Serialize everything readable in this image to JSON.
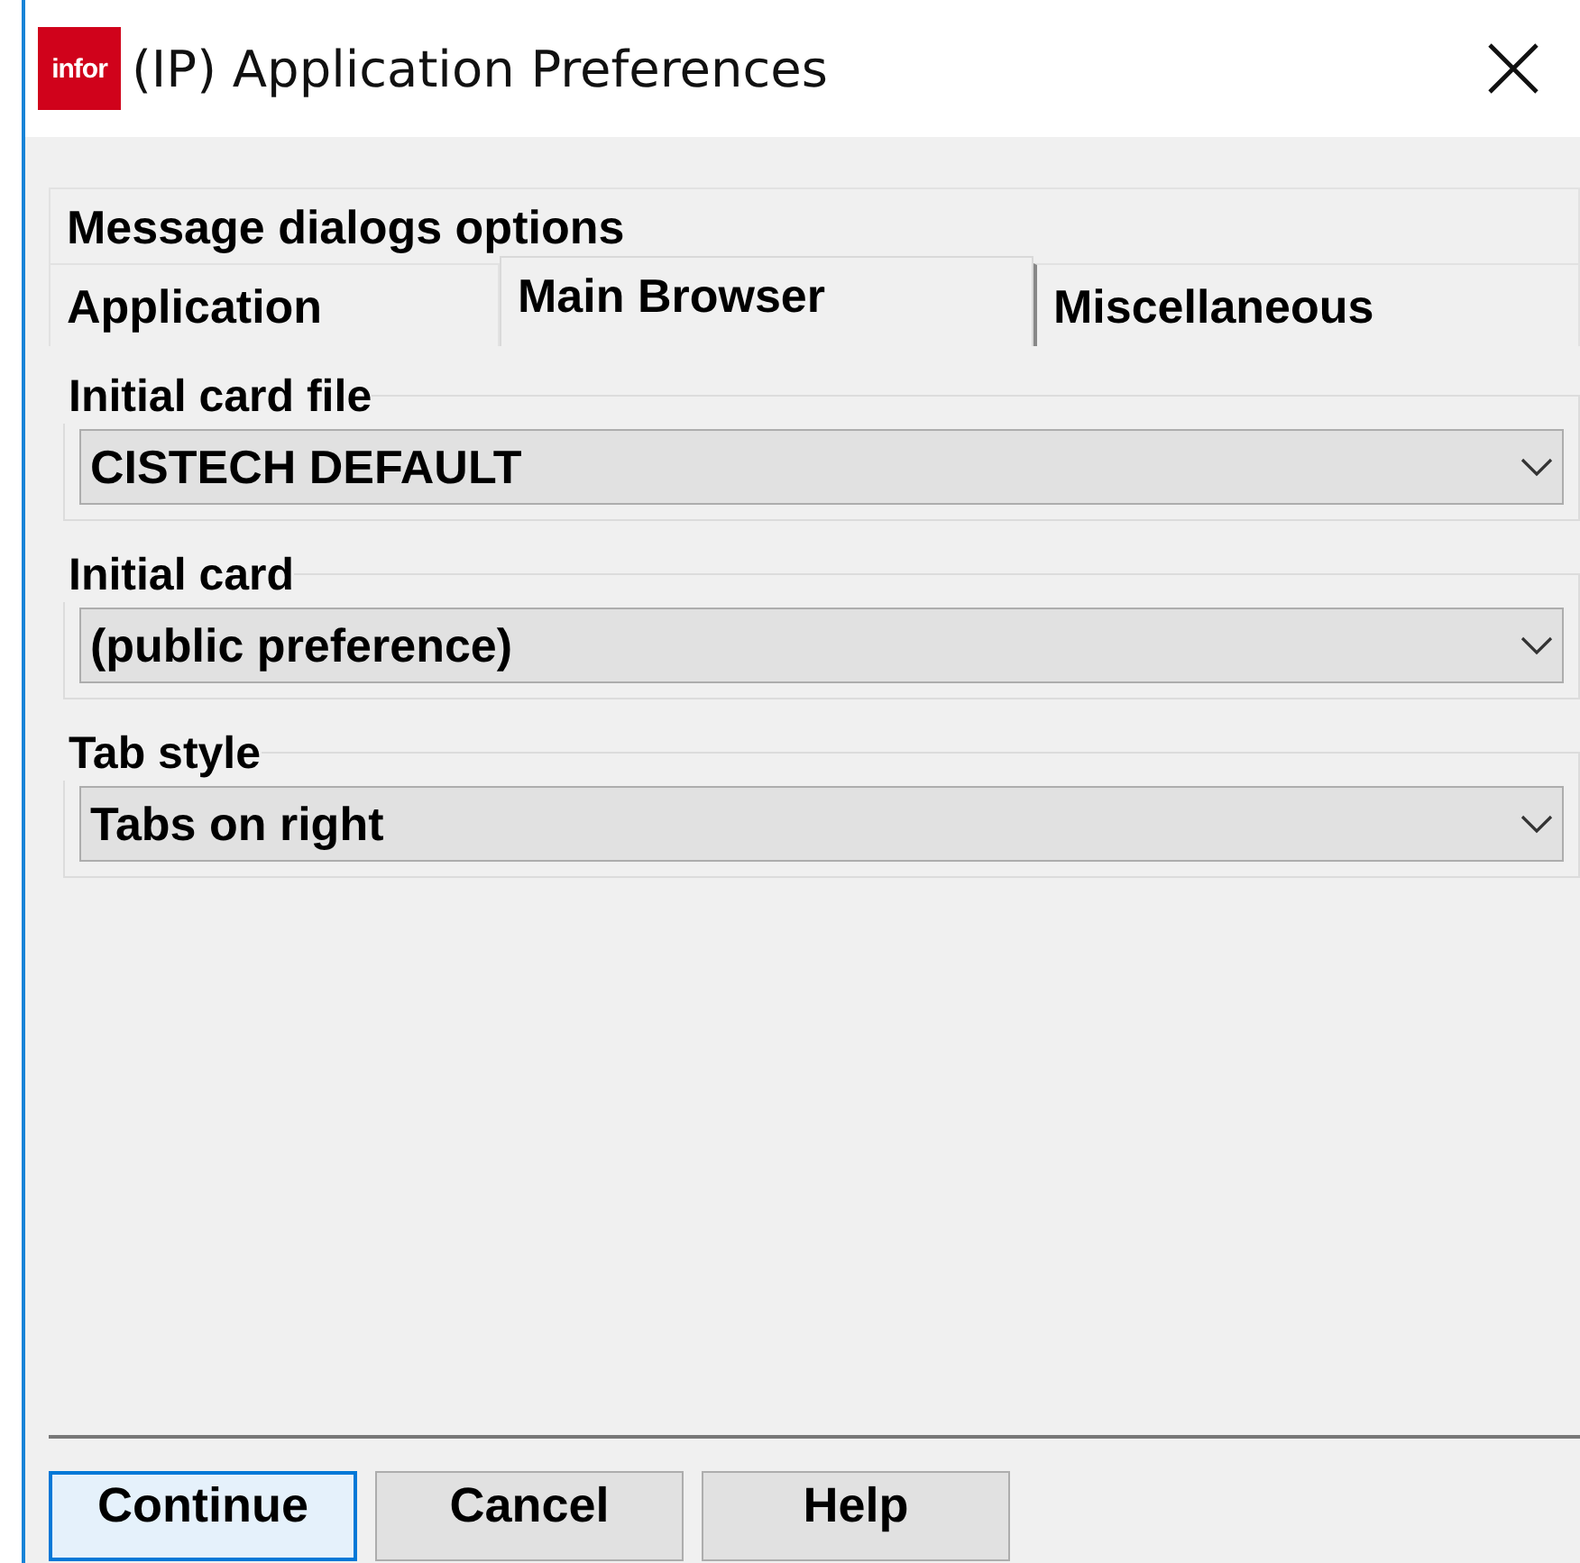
{
  "window": {
    "title": "(IP) Application Preferences",
    "logo": "infor"
  },
  "tab_rows": [
    [
      {
        "label": "Message dialogs options",
        "selected": false
      }
    ],
    [
      {
        "label": "Application",
        "selected": false
      },
      {
        "label": "Main Browser",
        "selected": true
      },
      {
        "label": "Miscellaneous",
        "selected": false
      }
    ]
  ],
  "groups": [
    {
      "label": "Initial card file",
      "value": "CISTECH DEFAULT"
    },
    {
      "label": "Initial card",
      "value": "(public preference)"
    },
    {
      "label": "Tab style",
      "value": "Tabs on right"
    }
  ],
  "buttons": [
    {
      "label": "Continue",
      "focused": true
    },
    {
      "label": "Cancel",
      "focused": false
    },
    {
      "label": "Help",
      "focused": false
    }
  ]
}
